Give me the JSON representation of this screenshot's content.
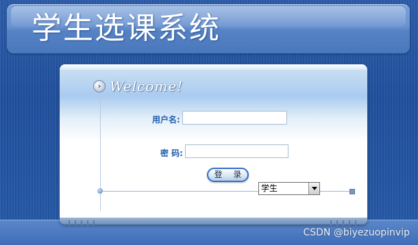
{
  "header": {
    "title": "学生选课系统"
  },
  "login_panel": {
    "welcome": "Welcome!",
    "username_label": "用户名:",
    "username_value": "",
    "password_label": "密 码:",
    "password_value": "",
    "login_button": "登 录",
    "role_select": {
      "selected": "学生"
    }
  },
  "watermark": "CSDN @biyezuopinvip",
  "colors": {
    "background": "#2458a6",
    "header": "#6a93d0",
    "label": "#1f5fae",
    "button_border": "#2e6fc4"
  },
  "icons": {
    "welcome": "circle-arrow-right-icon",
    "select": "chevron-down-icon"
  }
}
